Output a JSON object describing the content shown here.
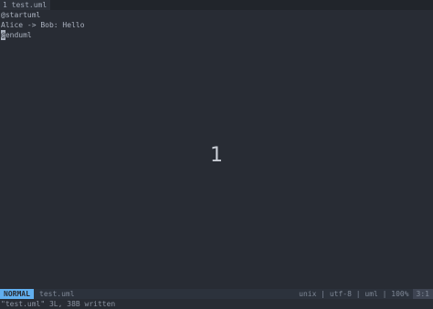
{
  "tabline": {
    "tab_label": "1 test.uml"
  },
  "buffer": {
    "lines": [
      "@startuml",
      "Alice -> Bob: Hello",
      "@enduml"
    ],
    "line3_cursor_char": "@",
    "line3_rest": "enduml"
  },
  "overlay": {
    "number": "1"
  },
  "statusline": {
    "mode": "NORMAL",
    "filename": "test.uml",
    "right_info": "unix | utf-8 | uml | 100%",
    "right_end": "3:1"
  },
  "cmdline": {
    "message": "\"test.uml\" 3L, 38B written"
  },
  "colors": {
    "background": "#282c34",
    "mode_accent": "#61afef",
    "text": "#abb2bf"
  }
}
